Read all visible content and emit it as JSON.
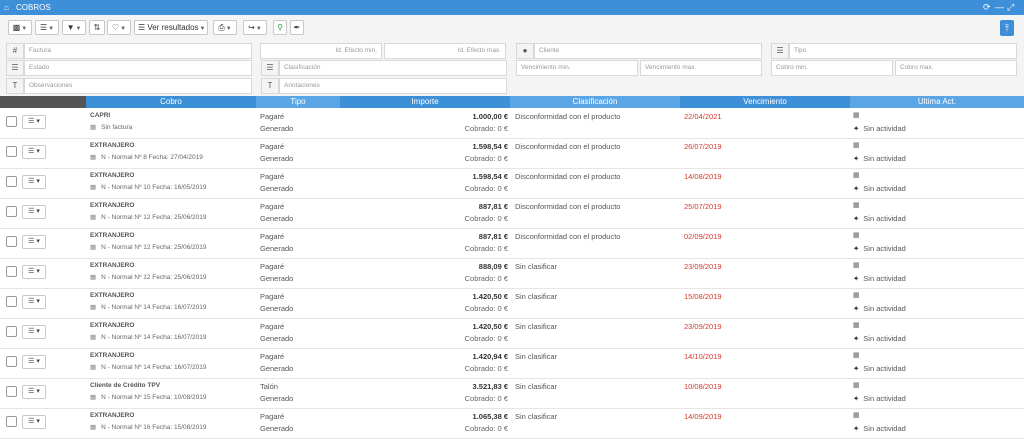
{
  "window": {
    "title": "COBROS",
    "home_icon": "home-icon",
    "controls": [
      "refresh-icon",
      "minimize-icon",
      "expand-icon"
    ]
  },
  "toolbar": {
    "view_results_label": "Ver resultados",
    "upload_label": "⤒"
  },
  "filters": {
    "factura": "Factura",
    "id_efecto_min": "Id. Efecto min.",
    "id_efecto_max": "Id. Efecto max.",
    "cliente": "Cliente",
    "tipo": "Tipo",
    "estado": "Estado",
    "clasificacion": "Clasificación",
    "vencimiento_min": "Vencimiento min.",
    "vencimiento_max": "Vencimiento max.",
    "cobro_min": "Cobro min.",
    "cobro_max": "Cobro max.",
    "observaciones": "Observaciones",
    "anotaciones": "Anotaciones"
  },
  "columns": [
    "Cobro",
    "Tipo",
    "Importe",
    "Clasificación",
    "Vencimiento",
    "Ultima Act."
  ],
  "rows": [
    {
      "client": "CAPRI",
      "detail": "Sin factura",
      "tipo": "Pagaré",
      "estado": "Generado",
      "importe": "1.000,00 €",
      "cobrado": "Cobrado: 0 €",
      "clasificacion": "Disconformidad con el producto",
      "vencimiento": "22/04/2021",
      "actividad": "Sin actividad"
    },
    {
      "client": "EXTRANJERO",
      "detail": "N - Normal Nº 8 Fecha: 27/04/2019",
      "tipo": "Pagaré",
      "estado": "Generado",
      "importe": "1.598,54 €",
      "cobrado": "Cobrado: 0 €",
      "clasificacion": "Disconformidad con el producto",
      "vencimiento": "26/07/2019",
      "actividad": "Sin actividad"
    },
    {
      "client": "EXTRANJERO",
      "detail": "N - Normal Nº 10 Fecha: 16/05/2019",
      "tipo": "Pagaré",
      "estado": "Generado",
      "importe": "1.598,54 €",
      "cobrado": "Cobrado: 0 €",
      "clasificacion": "Disconformidad con el producto",
      "vencimiento": "14/08/2019",
      "actividad": "Sin actividad"
    },
    {
      "client": "EXTRANJERO",
      "detail": "N - Normal Nº 12 Fecha: 25/06/2019",
      "tipo": "Pagaré",
      "estado": "Generado",
      "importe": "887,81 €",
      "cobrado": "Cobrado: 0 €",
      "clasificacion": "Disconformidad con el producto",
      "vencimiento": "25/07/2019",
      "actividad": "Sin actividad"
    },
    {
      "client": "EXTRANJERO",
      "detail": "N - Normal Nº 12 Fecha: 25/06/2019",
      "tipo": "Pagaré",
      "estado": "Generado",
      "importe": "887,81 €",
      "cobrado": "Cobrado: 0 €",
      "clasificacion": "Disconformidad con el producto",
      "vencimiento": "02/09/2019",
      "actividad": "Sin actividad"
    },
    {
      "client": "EXTRANJERO",
      "detail": "N - Normal Nº 12 Fecha: 25/06/2019",
      "tipo": "Pagaré",
      "estado": "Generado",
      "importe": "888,09 €",
      "cobrado": "Cobrado: 0 €",
      "clasificacion": "Sin clasificar",
      "vencimiento": "23/09/2019",
      "actividad": "Sin actividad"
    },
    {
      "client": "EXTRANJERO",
      "detail": "N - Normal Nº 14 Fecha: 16/07/2019",
      "tipo": "Pagaré",
      "estado": "Generado",
      "importe": "1.420,50 €",
      "cobrado": "Cobrado: 0 €",
      "clasificacion": "Sin clasificar",
      "vencimiento": "15/08/2019",
      "actividad": "Sin actividad"
    },
    {
      "client": "EXTRANJERO",
      "detail": "N - Normal Nº 14 Fecha: 16/07/2019",
      "tipo": "Pagaré",
      "estado": "Generado",
      "importe": "1.420,50 €",
      "cobrado": "Cobrado: 0 €",
      "clasificacion": "Sin clasificar",
      "vencimiento": "23/09/2019",
      "actividad": "Sin actividad"
    },
    {
      "client": "EXTRANJERO",
      "detail": "N - Normal Nº 14 Fecha: 16/07/2019",
      "tipo": "Pagaré",
      "estado": "Generado",
      "importe": "1.420,94 €",
      "cobrado": "Cobrado: 0 €",
      "clasificacion": "Sin clasificar",
      "vencimiento": "14/10/2019",
      "actividad": "Sin actividad"
    },
    {
      "client": "Cliente de Crédito TPV",
      "detail": "N - Normal Nº 15 Fecha: 10/08/2019",
      "tipo": "Talón",
      "estado": "Generado",
      "importe": "3.521,83 €",
      "cobrado": "Cobrado: 0 €",
      "clasificacion": "Sin clasificar",
      "vencimiento": "10/08/2019",
      "actividad": "Sin actividad"
    },
    {
      "client": "EXTRANJERO",
      "detail": "N - Normal Nº 16 Fecha: 15/08/2019",
      "tipo": "Pagaré",
      "estado": "Generado",
      "importe": "1.065,38 €",
      "cobrado": "Cobrado: 0 €",
      "clasificacion": "Sin clasificar",
      "vencimiento": "14/09/2019",
      "actividad": "Sin actividad"
    }
  ],
  "colors": {
    "accent": "#3d8fd8",
    "accent_alt": "#5aa5e6",
    "due_date": "#d9372b"
  }
}
